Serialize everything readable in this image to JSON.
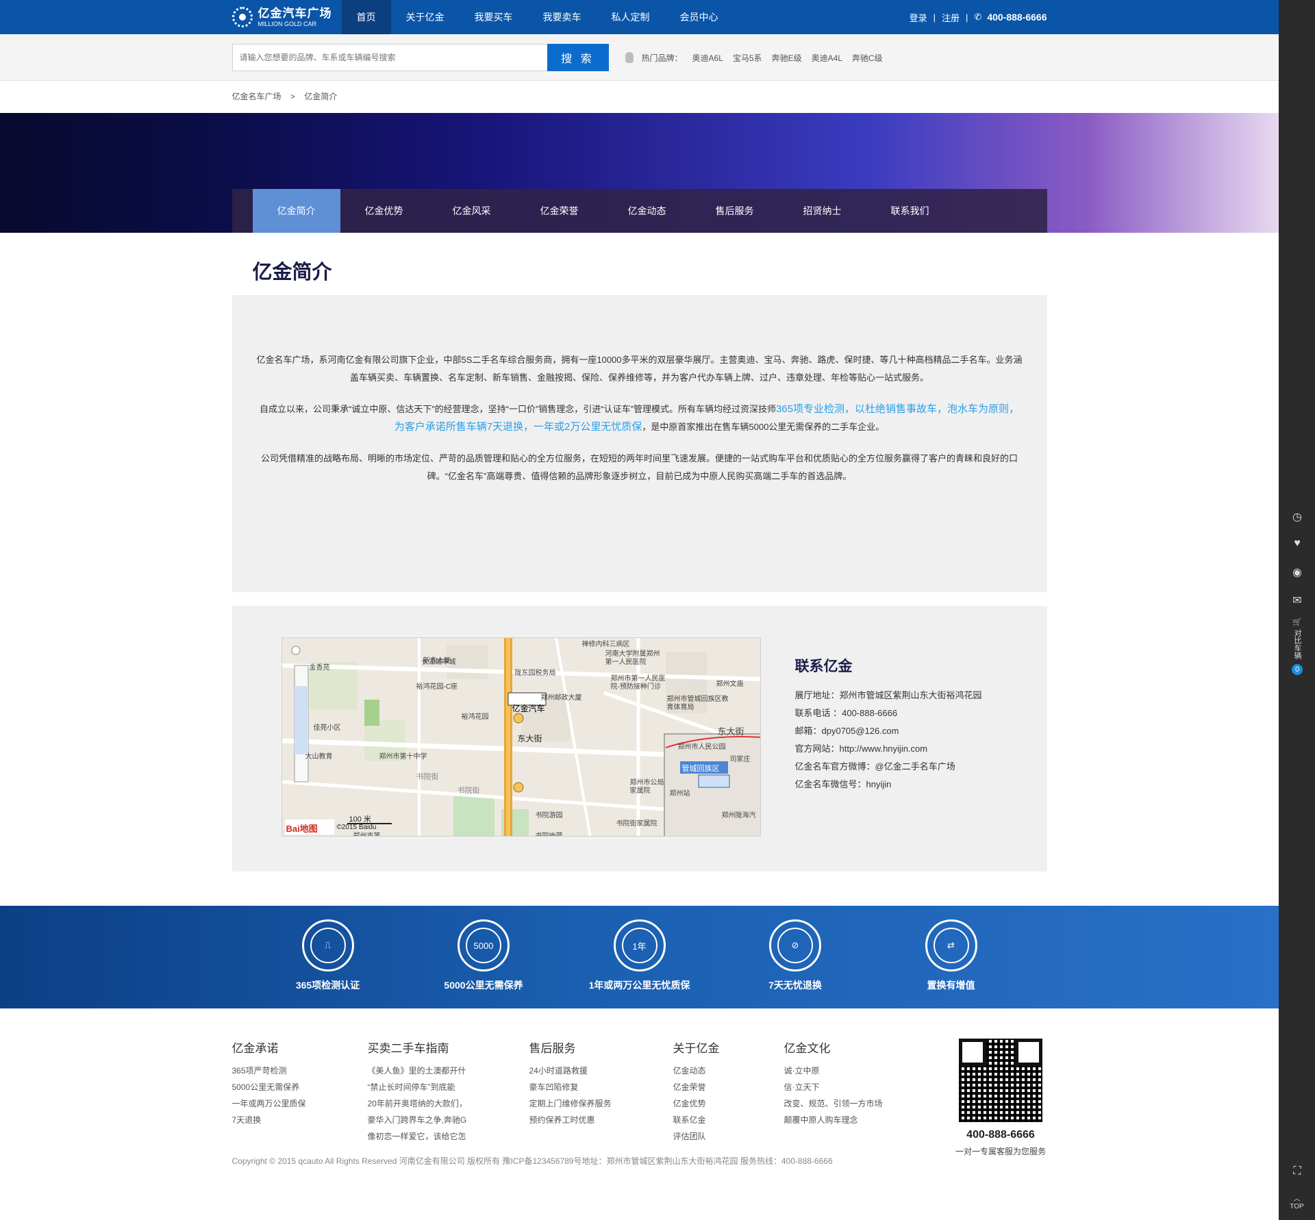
{
  "brand": {
    "name_cn": "亿金汽车广场",
    "name_en": "MILLION GOLD CAR"
  },
  "nav": {
    "items": [
      {
        "label": "首页"
      },
      {
        "label": "关于亿金"
      },
      {
        "label": "我要买车"
      },
      {
        "label": "我要卖车"
      },
      {
        "label": "私人定制"
      },
      {
        "label": "会员中心"
      }
    ],
    "login": "登录",
    "register": "注册",
    "phone": "400-888-6666"
  },
  "search": {
    "placeholder": "请输入您想要的品牌、车系或车辆编号搜索",
    "button": "搜 索",
    "hot_label": "热门品牌：",
    "hot_brands": [
      "奥迪A6L",
      "宝马5系",
      "奔驰E级",
      "奥迪A4L",
      "奔驰C级"
    ]
  },
  "breadcrumb": {
    "root": "亿金名车广场",
    "sep": ">",
    "current": "亿金简介"
  },
  "subnav": {
    "items": [
      {
        "label": "亿金简介"
      },
      {
        "label": "亿金优势"
      },
      {
        "label": "亿金风采"
      },
      {
        "label": "亿金荣誉"
      },
      {
        "label": "亿金动态"
      },
      {
        "label": "售后服务"
      },
      {
        "label": "招贤纳士"
      },
      {
        "label": "联系我们"
      }
    ]
  },
  "intro": {
    "title": "亿金简介",
    "p1": "亿金名车广场，系河南亿金有限公司旗下企业，中部5S二手名车综合服务商，拥有一座10000多平米的双层豪华展厅。主营奥迪、宝马、奔驰、路虎、保时捷、等几十种高档精品二手名车。业务涵盖车辆买卖、车辆置换、名车定制、新车销售、金融按揭、保险、保养维修等，并为客户代办车辆上牌、过户、违章处理、年检等贴心一站式服务。",
    "p2_a": "自成立以来，公司秉承“诚立中原、信达天下”的经营理念，坚持“一口价”销售理念，引进“认证车”管理模式。所有车辆均经过资深技师",
    "p2_hl": "365项专业检测，以杜绝销售事故车，泡水车为原则，为客户承诺所售车辆7天退换，一年或2万公里无忧质保",
    "p2_b": "，是中原首家推出在售车辆5000公里无需保养的二手车企业。",
    "p3": "公司凭借精准的战略布局、明晰的市场定位、严苛的品质管理和贴心的全方位服务，在短短的两年时间里飞速发展。便捷的一站式购车平台和优质贴心的全方位服务赢得了客户的青睐和良好的口碑。“亿金名车”高端尊贵、值得信赖的品牌形象逐步树立，目前已成为中原人民购买高端二手车的首选品牌。"
  },
  "map": {
    "marker_label": "亿金汽车",
    "places": [
      "新鑫大厦",
      "禅修内科三病区",
      "长江城中城",
      "河南大学附属郑州第一人民医院",
      "金香苑",
      "陇东园税务局",
      "郑州市第一人民医院-预防接种门诊",
      "郑州文庙",
      "裕鸿花园-C座",
      "郑州邮政大厦",
      "裕鸿花园",
      "郑州市管城回族区教育体育局",
      "东大街",
      "佳苑小区",
      "大山教育",
      "郑州市第十中学",
      "书院街",
      "郑州市公局家属院",
      "书院游园",
      "书院街家属院",
      "书院街",
      "郑州市第",
      "书院幽荷",
      "东大街"
    ],
    "inset": [
      "郑州市人民公园",
      "司家庄",
      "管城回族区",
      "郑州站",
      "郑州陇海汽"
    ],
    "scale": "100 米",
    "copyright": "©2015 Baidu",
    "logo": "Bai地图"
  },
  "contact": {
    "title": "联系亿金",
    "lines": [
      "展厅地址：郑州市管城区紫荆山东大街裕鸿花园",
      "联系电话 ：400-888-6666",
      "邮箱：dpy0705@126.com",
      "官方网站：http://www.hnyijin.com",
      "亿金名车官方微博：@亿金二手名车广场",
      "亿金名车微信号：hnyijin"
    ]
  },
  "guarantees": [
    {
      "label": "365项检测认证",
      "icon": "stamp-icon",
      "inner": ""
    },
    {
      "label": "5000公里无需保养",
      "icon": "5000-icon",
      "inner": "5000"
    },
    {
      "label": "1年或两万公里无忧质保",
      "icon": "one-year-icon",
      "inner": "1年"
    },
    {
      "label": "7天无忧退换",
      "icon": "no-car-icon",
      "inner": ""
    },
    {
      "label": "置换有增值",
      "icon": "car-swap-icon",
      "inner": ""
    }
  ],
  "footer": {
    "cols": [
      {
        "title": "亿金承诺",
        "links": [
          "365项严苛检测",
          "5000公里无需保养",
          "一年或两万公里质保",
          "7天退换"
        ]
      },
      {
        "title": "买卖二手车指南",
        "links": [
          "《美人鱼》里的土澳都开什",
          "“禁止长时间停车”到底能",
          "20年前开奥塔纳的大款们，",
          "豪华入门跨界车之争,奔驰G",
          "像初恋一样爱它，该给它怎"
        ]
      },
      {
        "title": "售后服务",
        "links": [
          "24小时道路救援",
          "豪车凹陷修复",
          "定期上门维修保养服务",
          "预约保养工时优惠"
        ]
      },
      {
        "title": "关于亿金",
        "links": [
          "亿金动态",
          "亿金荣誉",
          "亿金优势",
          "联系亿金",
          "评估团队"
        ]
      },
      {
        "title": "亿金文化",
        "links": [
          "诚·立中原",
          "信·立天下",
          "改变、规范、引领一方市场",
          "颠覆中原人购车理念"
        ]
      }
    ],
    "qr_tel": "400-888-6666",
    "qr_sub": "一对一专属客服为您服务",
    "copyright": "Copyright © 2015 qcauto All Rights Reserved 河南亿金有限公司 版权所有 豫ICP备123456789号",
    "address": "地址：郑州市管城区紫荆山东大街裕鸿花园 服务热线：400-888-6666"
  },
  "sidebar": {
    "cart_label": "对比车辆",
    "cart_count": "0",
    "top_label": "TOP"
  }
}
